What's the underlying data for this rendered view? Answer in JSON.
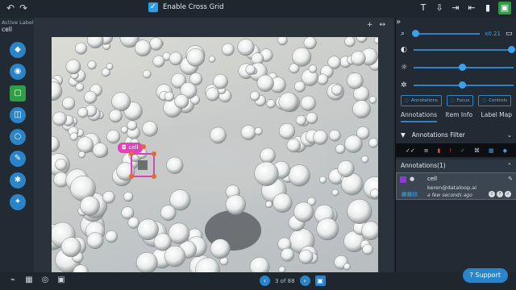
{
  "topbar": {
    "cross_grid_label": "Enable Cross Grid",
    "cross_grid_checked": true
  },
  "sidebar": {
    "active_label_title": "Active Label",
    "active_label_value": "cell"
  },
  "canvas": {
    "annotation_tag": "cell"
  },
  "right_panel": {
    "zoom_value": "x0.21",
    "opacity_level": 1.0,
    "brightness_level": 0.45,
    "contrast_level": 0.45,
    "visibility_buttons": [
      "Annotations",
      "Focus",
      "Controls"
    ],
    "tabs": [
      "Annotations",
      "Item Info",
      "Label Map"
    ],
    "filter_label": "Annotations Filter",
    "annotations_header": "Annotations(1)",
    "annotation": {
      "name": "cell",
      "email": "keren@dataloop.ai",
      "time": "a few seconds ago",
      "color": "#8a3bd0"
    }
  },
  "footer": {
    "pager_text": "3 of 88",
    "support_label": "Support"
  },
  "colors": {
    "accent": "#2a84c9",
    "annotation_box": "#e040c0",
    "save_button": "#2e9a45"
  }
}
